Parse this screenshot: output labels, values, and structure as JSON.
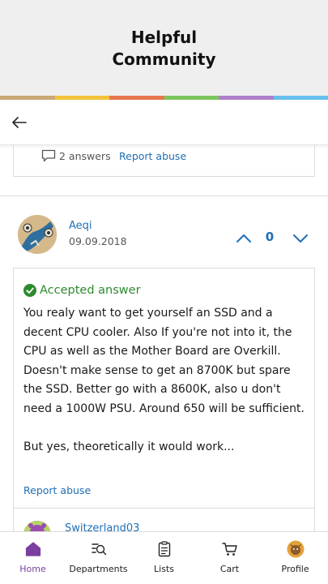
{
  "header": {
    "title": "Helpful\nCommunity",
    "stripe_colors": [
      "#c9a777",
      "#f3c43b",
      "#e8774f",
      "#7cc55e",
      "#b07fc9",
      "#68c0ee"
    ]
  },
  "navbar": {
    "back_icon": "arrow-left-icon"
  },
  "previous_post": {
    "answers_label": "2 answers",
    "report_label": "Report abuse"
  },
  "answer": {
    "author": "Aeqi",
    "date": "09.09.2018",
    "votes": "0",
    "accepted_label": "Accepted answer",
    "text": "You realy want to get yourself an SSD and a decent CPU cooler. Also If you're not into it, the CPU as well as the Mother Board are Overkill. Doesn't make sense to get an 8700K but spare the SSD. Better go with a 8600K, also u don't need a 1000W PSU. Around 650 will be sufficient.\n\nBut yes, theoretically it would work...",
    "report_label": "Report abuse"
  },
  "next_answer": {
    "author": "Switzerland03"
  },
  "tabs": [
    {
      "label": "Home",
      "icon": "home-icon",
      "active": true
    },
    {
      "label": "Departments",
      "icon": "departments-search-icon",
      "active": false
    },
    {
      "label": "Lists",
      "icon": "clipboard-list-icon",
      "active": false
    },
    {
      "label": "Cart",
      "icon": "cart-icon",
      "active": false
    },
    {
      "label": "Profile",
      "icon": "profile-avatar-icon",
      "active": false
    }
  ],
  "colors": {
    "link": "#1f6fb5",
    "accepted": "#2e8a2e",
    "active_tab": "#7a3ea0"
  }
}
